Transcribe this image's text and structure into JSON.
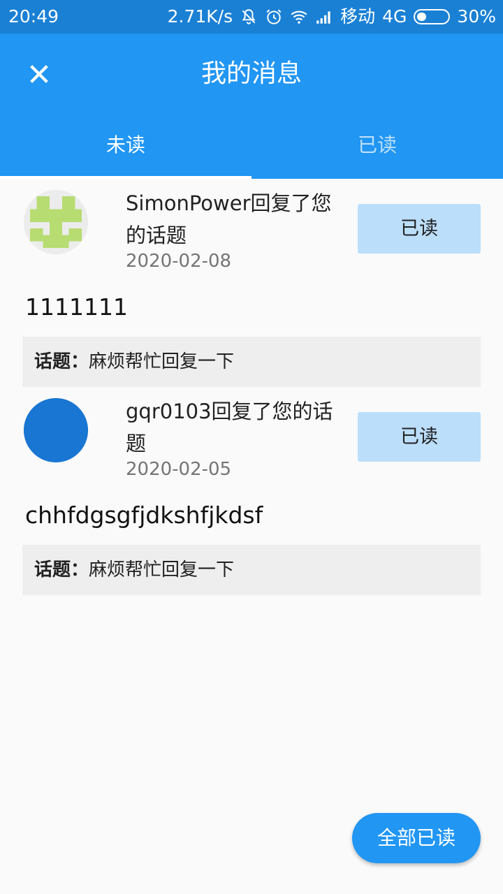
{
  "status_bar": {
    "time": "20:49",
    "speed": "2.71K/s",
    "carrier": "移动",
    "network": "4G",
    "battery": "30%",
    "battery_level": 0.3
  },
  "app_bar": {
    "title": "我的消息",
    "close_icon": "close-icon"
  },
  "tabs": [
    {
      "label": "未读",
      "selected": true
    },
    {
      "label": "已读",
      "selected": false
    }
  ],
  "messages": [
    {
      "title": "SimonPower回复了您的话题",
      "date": "2020-02-08",
      "button_label": "已读",
      "content": "1111111",
      "topic_label": "话题：",
      "topic": "麻烦帮忙回复一下",
      "avatar": "identicon-avatar"
    },
    {
      "title": "gqr0103回复了您的话题",
      "date": "2020-02-05",
      "button_label": "已读",
      "content": "chhfdgsgfjdkshfjkdsf",
      "topic_label": "话题：",
      "topic": "麻烦帮忙回复一下",
      "avatar": "blue-circle-avatar"
    }
  ],
  "fab": {
    "label": "全部已读"
  },
  "colors": {
    "primary": "#2196f3",
    "status_bar": "#1a80d4",
    "read_button": "#bbdefb",
    "topic_bg": "#eeeeee",
    "avatar_green": "#b7dc72",
    "avatar_blue": "#1976d2"
  }
}
